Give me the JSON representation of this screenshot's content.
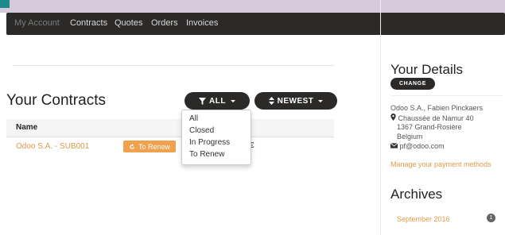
{
  "nav": {
    "items": [
      "My Account",
      "Contracts",
      "Quotes",
      "Orders",
      "Invoices"
    ]
  },
  "main": {
    "title": "Your Contracts",
    "filter_button": "ALL",
    "sort_button": "NEWEST",
    "table": {
      "header": "Name",
      "rows": [
        {
          "name": "Odoo S.A. - SUB001",
          "badge": "To Renew",
          "amount": "€"
        }
      ]
    },
    "filter_menu": {
      "options": [
        "All",
        "Closed",
        "In Progress",
        "To Renew"
      ]
    }
  },
  "sidebar": {
    "details_title": "Your Details",
    "change_label": "CHANGE",
    "address": {
      "company_contact": "Odoo S.A., Fabien Pinckaers",
      "street": "Chaussée de Namur 40",
      "city": "1367 Grand-Rosière",
      "country": "Belgium",
      "email": "pf@odoo.com"
    },
    "payment_link": "Manage your payment methods",
    "archives_title": "Archives",
    "archives": [
      {
        "label": "September 2016",
        "count": "1"
      }
    ]
  },
  "colors": {
    "accent": "#e09a47",
    "dark": "#2b2a28",
    "badge": "#f0a14e"
  }
}
